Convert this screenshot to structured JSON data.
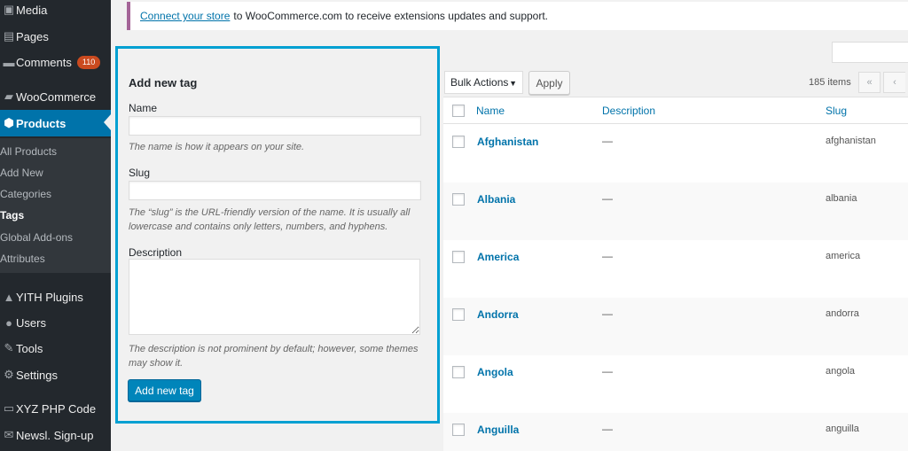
{
  "sidebar": {
    "items": [
      {
        "label": "Media",
        "icon": "media-icon",
        "glyph": "▣",
        "badge": ""
      },
      {
        "label": "Pages",
        "icon": "pages-icon",
        "glyph": "▤",
        "badge": ""
      },
      {
        "label": "Comments",
        "icon": "comments-icon",
        "glyph": "▬",
        "badge": "110"
      },
      {
        "label": "WooCommerce",
        "icon": "woocommerce-icon",
        "glyph": "▰",
        "badge": ""
      },
      {
        "label": "Products",
        "icon": "products-icon",
        "glyph": "⬢",
        "badge": ""
      },
      {
        "label": "YITH Plugins",
        "icon": "yith-icon",
        "glyph": "▲",
        "badge": ""
      },
      {
        "label": "Users",
        "icon": "users-icon",
        "glyph": "●",
        "badge": ""
      },
      {
        "label": "Tools",
        "icon": "tools-icon",
        "glyph": "✎",
        "badge": ""
      },
      {
        "label": "Settings",
        "icon": "settings-icon",
        "glyph": "⚙",
        "badge": ""
      },
      {
        "label": "XYZ PHP Code",
        "icon": "php-icon",
        "glyph": "▭",
        "badge": ""
      },
      {
        "label": "Newsl. Sign-up",
        "icon": "newsletter-icon",
        "glyph": "✉",
        "badge": ""
      }
    ],
    "submenu": [
      "All Products",
      "Add New",
      "Categories",
      "Tags",
      "Global Add-ons",
      "Attributes"
    ]
  },
  "notice": {
    "link": "Connect your store",
    "text": "to WooCommerce.com to receive extensions updates and support."
  },
  "form": {
    "title": "Add new tag",
    "name_label": "Name",
    "name_help": "The name is how it appears on your site.",
    "slug_label": "Slug",
    "slug_help": "The “slug” is the URL-friendly version of the name. It is usually all lowercase and contains only letters, numbers, and hyphens.",
    "description_label": "Description",
    "description_help": "The description is not prominent by default; however, some themes may show it.",
    "submit": "Add new tag"
  },
  "toolbar": {
    "bulk_actions": "Bulk Actions",
    "apply": "Apply",
    "items_count": "185 items",
    "first_page": "«",
    "prev_page": "‹"
  },
  "table": {
    "columns": {
      "name": "Name",
      "description": "Description",
      "slug": "Slug"
    },
    "rows": [
      {
        "name": "Afghanistan",
        "description": "—",
        "slug": "afghanistan"
      },
      {
        "name": "Albania",
        "description": "—",
        "slug": "albania"
      },
      {
        "name": "America",
        "description": "—",
        "slug": "america"
      },
      {
        "name": "Andorra",
        "description": "—",
        "slug": "andorra"
      },
      {
        "name": "Angola",
        "description": "—",
        "slug": "angola"
      },
      {
        "name": "Anguilla",
        "description": "—",
        "slug": "anguilla"
      }
    ]
  },
  "colors": {
    "accent": "#0073aa",
    "highlight": "#00a0d2",
    "badge": "#ca4a1f",
    "sidebar": "#23282d"
  }
}
